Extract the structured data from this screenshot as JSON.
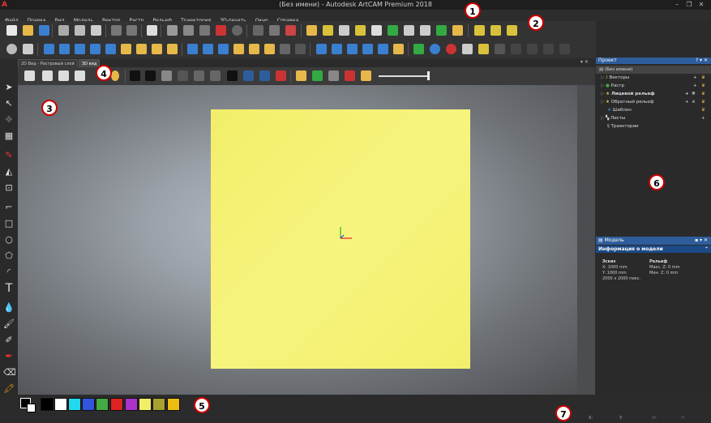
{
  "window": {
    "title": "(Без имени) - Autodesk ArtCAM Premium 2018",
    "app_icon": "A"
  },
  "menu": [
    "Файл",
    "Правка",
    "Вид",
    "Модель",
    "Вектор",
    "Растр",
    "Рельеф",
    "Траектория",
    "3D-печать",
    "Окно",
    "Справка"
  ],
  "tabs": {
    "raster": "2D Вид - Растровый слой",
    "view3d": "3D вид"
  },
  "project_panel": {
    "header": "Проект",
    "header_controls": "? ▾ ✕",
    "items": [
      "(Без имени)",
      "Векторы",
      "Растр",
      "Лицевой рельеф",
      "Обратный рельеф",
      "Шаблон",
      "Листы",
      "Траектории"
    ]
  },
  "model_panel": {
    "header": "Модель",
    "section": "Информация о модели",
    "sketch_title": "Эскиз",
    "sketch_x": "X: 1000 mm",
    "sketch_y": "Y: 1000 mm",
    "sketch_px": "2000 x 2000 пикс.",
    "relief_title": "Рельеф",
    "relief_max": "Макс. Z: 0 mm",
    "relief_min": "Мин. Z: 0 mm"
  },
  "status": {
    "x": "X:",
    "y": "Y:",
    "z": "Z:",
    "w": "W:",
    "h": "H:"
  },
  "palette_colors": [
    "#000000",
    "#ffffff",
    "#22d8ee",
    "#3355dd",
    "#44aa44",
    "#dd2222",
    "#aa33cc",
    "#f2ee6a",
    "#aaa030",
    "#eebb11"
  ],
  "callouts": [
    "1",
    "2",
    "3",
    "4",
    "5",
    "6",
    "7"
  ],
  "colors": {
    "accent": "#2e5d9b",
    "sheet": "#f4f07a"
  }
}
